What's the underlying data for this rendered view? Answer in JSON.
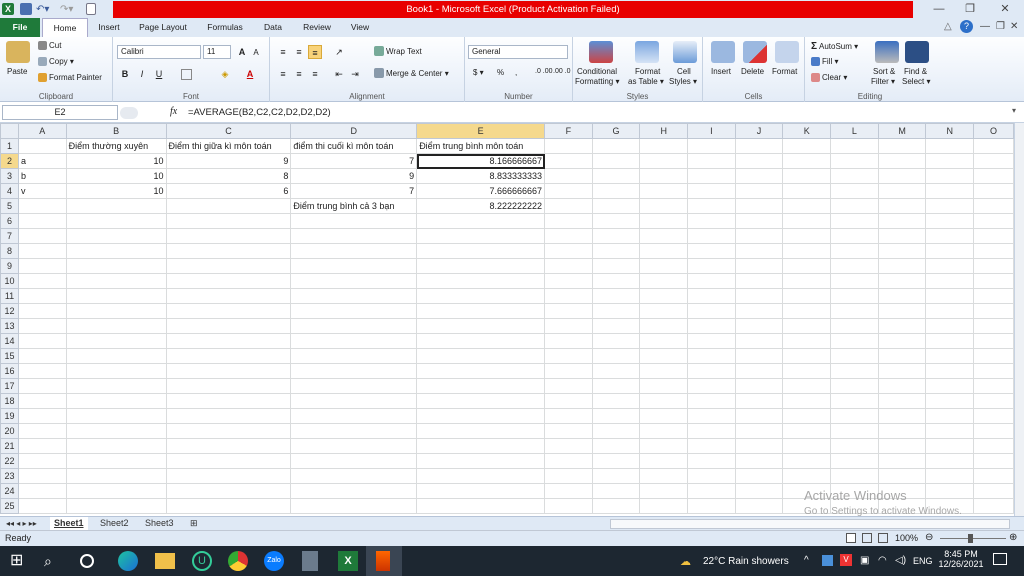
{
  "window": {
    "title": "Book1 - Microsoft Excel (Product Activation Failed)",
    "buttons": {
      "minimize": "—",
      "restore": "❐",
      "close": "✕"
    }
  },
  "ribbon_tabs": [
    "File",
    "Home",
    "Insert",
    "Page Layout",
    "Formulas",
    "Data",
    "Review",
    "View"
  ],
  "ribbon": {
    "clipboard": {
      "paste": "Paste",
      "cut": "Cut",
      "copy": "Copy ▾",
      "format_painter": "Format Painter",
      "label": "Clipboard"
    },
    "font": {
      "name": "Calibri",
      "size": "11",
      "label": "Font",
      "bold": "B",
      "italic": "I",
      "underline": "U",
      "grow": "A",
      "shrink": "A"
    },
    "alignment": {
      "wrap": "Wrap Text",
      "merge": "Merge & Center ▾",
      "label": "Alignment"
    },
    "number": {
      "format": "General",
      "currency": "$ ▾",
      "percent": "%",
      "comma": ",",
      "inc_dec": ".0 .00",
      "dec_dec": ".00 .0",
      "label": "Number"
    },
    "styles": {
      "conditional_1": "Conditional",
      "conditional_2": "Formatting ▾",
      "table_1": "Format",
      "table_2": "as Table ▾",
      "cell_1": "Cell",
      "cell_2": "Styles ▾",
      "label": "Styles"
    },
    "cells": {
      "insert": "Insert",
      "delete": "Delete",
      "format": "Format",
      "label": "Cells"
    },
    "editing": {
      "autosum": "AutoSum ▾",
      "fill": "Fill ▾",
      "clear": "Clear ▾",
      "sort_1": "Sort &",
      "sort_2": "Filter ▾",
      "find_1": "Find &",
      "find_2": "Select ▾",
      "label": "Editing"
    }
  },
  "formula_bar": {
    "name_box": "E2",
    "fx": "fx",
    "formula": "=AVERAGE(B2,C2,C2,D2,D2,D2)"
  },
  "grid": {
    "columns": [
      "A",
      "B",
      "C",
      "D",
      "E",
      "F",
      "G",
      "H",
      "I",
      "J",
      "K",
      "L",
      "M",
      "N",
      "O"
    ],
    "rows": [
      [
        "",
        "Điểm thường xuyên",
        "Điểm thi giữa kì môn toán",
        "điểm thi cuối kì môn toán",
        "Điểm trung bình môn toán"
      ],
      [
        "a",
        "10",
        "9",
        "7",
        "8.166666667"
      ],
      [
        "b",
        "10",
        "8",
        "9",
        "8.833333333"
      ],
      [
        "v",
        "10",
        "6",
        "7",
        "7.666666667"
      ],
      [
        "",
        "",
        "",
        "Điểm trung bình cả 3 bạn",
        "8.222222222"
      ]
    ],
    "row_count": 25
  },
  "sheets": [
    "Sheet1",
    "Sheet2",
    "Sheet3"
  ],
  "status": {
    "ready": "Ready",
    "zoom": "100%"
  },
  "watermark": {
    "line1": "Activate Windows",
    "line2": "Go to Settings to activate Windows."
  },
  "taskbar": {
    "weather": "22°C  Rain showers",
    "lang": "ENG",
    "time": "8:45 PM",
    "date": "12/26/2021"
  }
}
